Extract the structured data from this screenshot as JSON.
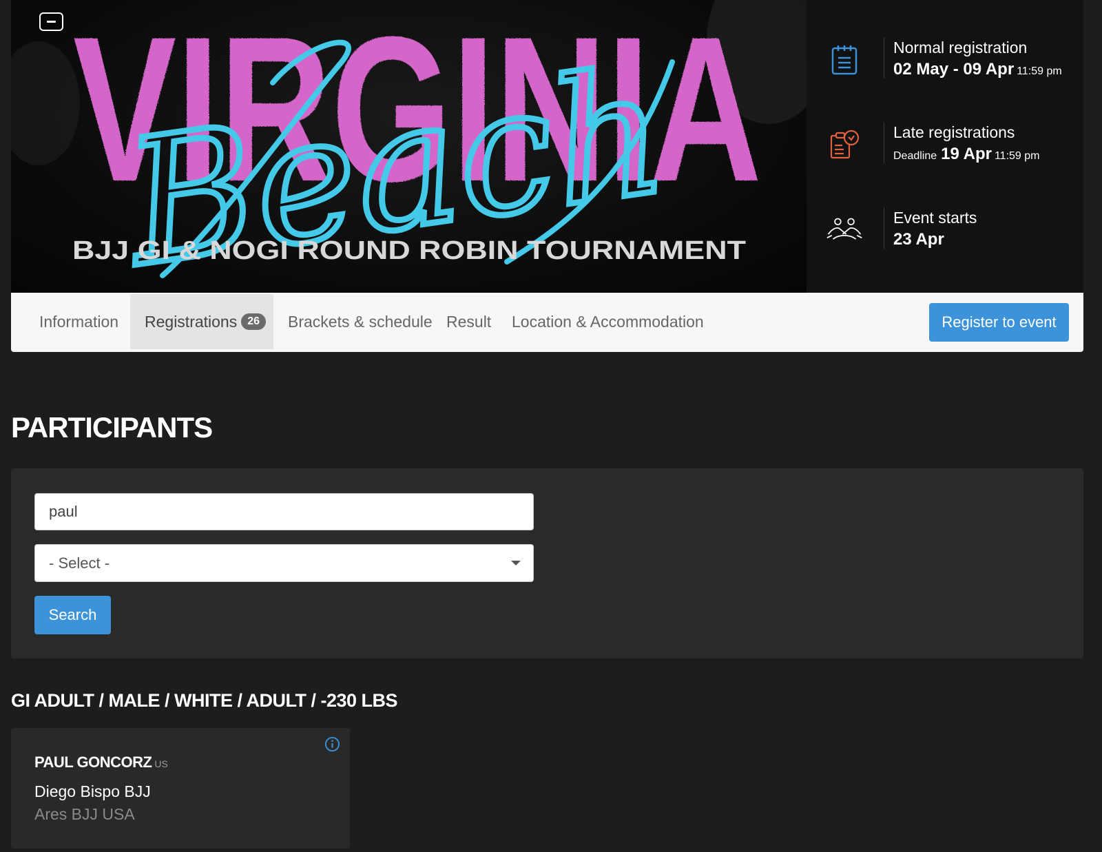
{
  "banner": {
    "title_main": "VIRGINIA",
    "title_script": "Beach",
    "subtitle": "BJJ GI & NOGI ROUND ROBIN TOURNAMENT",
    "colors": {
      "pink": "#d466c9",
      "cyan": "#45c9e8"
    }
  },
  "dates": {
    "normal": {
      "icon": "calendar-icon",
      "label": "Normal registration",
      "range": "02 May - 09 Apr",
      "time": "11:59 pm"
    },
    "late": {
      "icon": "clipboard-clock-icon",
      "label": "Late registrations",
      "prefix": "Deadline",
      "date": "19 Apr",
      "time": "11:59 pm"
    },
    "start": {
      "icon": "grappling-icon",
      "label": "Event starts",
      "date": "23 Apr"
    }
  },
  "tabs": [
    {
      "label": "Information"
    },
    {
      "label": "Registrations",
      "badge": "26"
    },
    {
      "label": "Brackets & schedule"
    },
    {
      "label": "Result"
    },
    {
      "label": "Location & Accommodation"
    }
  ],
  "register_button": "Register to event",
  "participants": {
    "title": "PARTICIPANTS",
    "search_value": "paul",
    "select_value": "- Select -",
    "search_button": "Search"
  },
  "category": {
    "title": "GI ADULT / MALE / WHITE / ADULT / -230 LBS",
    "athletes": [
      {
        "name": "PAUL GONCORZ",
        "country": "US",
        "team": "Diego Bispo BJJ",
        "affiliation": "Ares BJJ USA"
      }
    ]
  },
  "accent_color": "#3d93d9"
}
